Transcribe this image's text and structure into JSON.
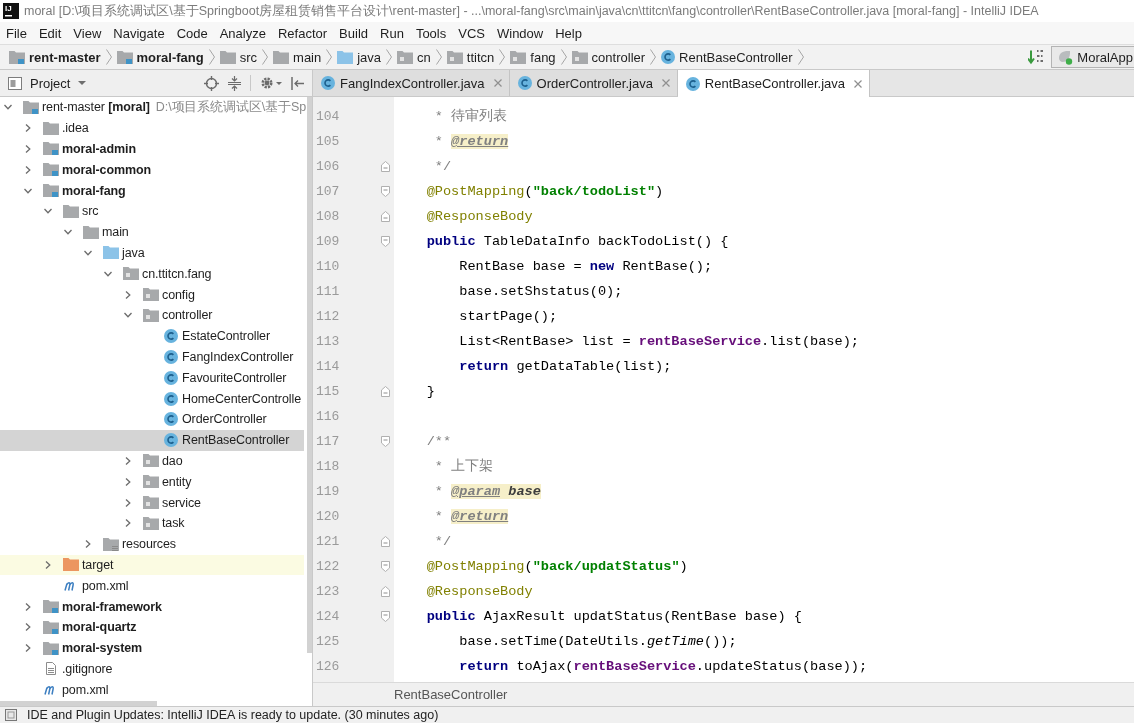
{
  "window": {
    "logo": "IJ",
    "title": "moral [D:\\项目系统调试区\\基于Springboot房屋租赁销售平台设计\\rent-master] - ...\\moral-fang\\src\\main\\java\\cn\\ttitcn\\fang\\controller\\RentBaseController.java [moral-fang] - IntelliJ IDEA"
  },
  "menu": [
    "File",
    "Edit",
    "View",
    "Navigate",
    "Code",
    "Analyze",
    "Refactor",
    "Build",
    "Run",
    "Tools",
    "VCS",
    "Window",
    "Help"
  ],
  "navigation_bar": {
    "crumbs": [
      {
        "kind": "module",
        "label": "rent-master"
      },
      {
        "kind": "module",
        "label": "moral-fang"
      },
      {
        "kind": "folder",
        "label": "src"
      },
      {
        "kind": "folder",
        "label": "main"
      },
      {
        "kind": "source-folder",
        "label": "java"
      },
      {
        "kind": "package",
        "label": "cn"
      },
      {
        "kind": "package",
        "label": "ttitcn"
      },
      {
        "kind": "package",
        "label": "fang"
      },
      {
        "kind": "package",
        "label": "controller"
      },
      {
        "kind": "class",
        "label": "RentBaseController"
      }
    ],
    "run_configuration": "MoralApp"
  },
  "project_panel": {
    "title": "Project",
    "tree": [
      {
        "kind": "project",
        "name": "rent-master **[moral]**",
        "location": "D:\\项目系统调试区\\基于Sp",
        "selected": false,
        "expanded": true,
        "children": [
          {
            "kind": "folder",
            "name": ".idea",
            "selected": false,
            "expanded": false
          },
          {
            "kind": "module",
            "name": "moral-admin",
            "selected": false,
            "expanded": false
          },
          {
            "kind": "module",
            "name": "moral-common",
            "selected": false,
            "expanded": false
          },
          {
            "kind": "module",
            "name": "moral-fang",
            "selected": false,
            "expanded": true,
            "children": [
              {
                "kind": "folder",
                "name": "src",
                "selected": false,
                "expanded": true,
                "children": [
                  {
                    "kind": "folder",
                    "name": "main",
                    "selected": false,
                    "expanded": true,
                    "children": [
                      {
                        "kind": "source-folder",
                        "name": "java",
                        "selected": false,
                        "expanded": true,
                        "children": [
                          {
                            "kind": "package",
                            "name": "cn.ttitcn.fang",
                            "selected": false,
                            "expanded": true,
                            "children": [
                              {
                                "kind": "package",
                                "name": "config",
                                "selected": false,
                                "expanded": false
                              },
                              {
                                "kind": "package",
                                "name": "controller",
                                "selected": false,
                                "expanded": true,
                                "children": [
                                  {
                                    "kind": "class",
                                    "name": "EstateController",
                                    "selected": false
                                  },
                                  {
                                    "kind": "class",
                                    "name": "FangIndexController",
                                    "selected": false
                                  },
                                  {
                                    "kind": "class",
                                    "name": "FavouriteController",
                                    "selected": false
                                  },
                                  {
                                    "kind": "class",
                                    "name": "HomeCenterControlle",
                                    "selected": false
                                  },
                                  {
                                    "kind": "class",
                                    "name": "OrderController",
                                    "selected": false
                                  },
                                  {
                                    "kind": "class",
                                    "name": "RentBaseController",
                                    "selected": true
                                  }
                                ]
                              },
                              {
                                "kind": "package",
                                "name": "dao",
                                "selected": false,
                                "expanded": false
                              },
                              {
                                "kind": "package",
                                "name": "entity",
                                "selected": false,
                                "expanded": false
                              },
                              {
                                "kind": "package",
                                "name": "service",
                                "selected": false,
                                "expanded": false
                              },
                              {
                                "kind": "package",
                                "name": "task",
                                "selected": false,
                                "expanded": false
                              }
                            ]
                          }
                        ]
                      },
                      {
                        "kind": "resources-folder",
                        "name": "resources",
                        "selected": false,
                        "expanded": false
                      }
                    ]
                  }
                ]
              },
              {
                "kind": "excluded-folder",
                "name": "target",
                "selected": false,
                "expanded": false
              },
              {
                "kind": "maven-file",
                "name": "pom.xml",
                "selected": false
              }
            ]
          },
          {
            "kind": "module",
            "name": "moral-framework",
            "selected": false,
            "expanded": false
          },
          {
            "kind": "module",
            "name": "moral-quartz",
            "selected": false,
            "expanded": false
          },
          {
            "kind": "module",
            "name": "moral-system",
            "selected": false,
            "expanded": false
          },
          {
            "kind": "text-file",
            "name": ".gitignore",
            "selected": false
          },
          {
            "kind": "maven-file",
            "name": "pom.xml",
            "selected": false
          }
        ]
      }
    ]
  },
  "editor_tabs": [
    {
      "label": "FangIndexController.java",
      "selected": false
    },
    {
      "label": "OrderController.java",
      "selected": false
    },
    {
      "label": "RentBaseController.java",
      "selected": true
    }
  ],
  "editor": {
    "lines": [
      {
        "number": "104",
        "fold_start": false,
        "fold_end": false,
        "tokens": [
          {
            "kind": "comment",
            "text": "     * 待审列表"
          }
        ]
      },
      {
        "number": "105",
        "fold_start": false,
        "fold_end": false,
        "tokens": [
          {
            "kind": "comment",
            "text": "     * "
          },
          {
            "kind": "doc-tag",
            "text": "@return"
          }
        ]
      },
      {
        "number": "106",
        "fold_start": false,
        "fold_end": true,
        "tokens": [
          {
            "kind": "comment",
            "text": "     */"
          }
        ]
      },
      {
        "number": "107",
        "fold_start": true,
        "fold_end": false,
        "tokens": [
          {
            "kind": "annotation",
            "text": "    @PostMapping"
          },
          {
            "kind": "plain",
            "text": "("
          },
          {
            "kind": "string",
            "text": "\"back/todoList\""
          },
          {
            "kind": "plain",
            "text": ")"
          }
        ]
      },
      {
        "number": "108",
        "fold_start": false,
        "fold_end": true,
        "tokens": [
          {
            "kind": "annotation",
            "text": "    @ResponseBody"
          }
        ]
      },
      {
        "number": "109",
        "fold_start": true,
        "fold_end": false,
        "tokens": [
          {
            "kind": "keyword",
            "text": "    public"
          },
          {
            "kind": "plain",
            "text": " TableDataInfo backTodoList() {"
          }
        ]
      },
      {
        "number": "110",
        "fold_start": false,
        "fold_end": false,
        "tokens": [
          {
            "kind": "plain",
            "text": "        RentBase base = "
          },
          {
            "kind": "keyword",
            "text": "new"
          },
          {
            "kind": "plain",
            "text": " RentBase();"
          }
        ]
      },
      {
        "number": "111",
        "fold_start": false,
        "fold_end": false,
        "tokens": [
          {
            "kind": "plain",
            "text": "        base.setShstatus(0);"
          }
        ]
      },
      {
        "number": "112",
        "fold_start": false,
        "fold_end": false,
        "tokens": [
          {
            "kind": "plain",
            "text": "        startPage();"
          }
        ]
      },
      {
        "number": "113",
        "fold_start": false,
        "fold_end": false,
        "tokens": [
          {
            "kind": "plain",
            "text": "        List<RentBase> list = "
          },
          {
            "kind": "field",
            "text": "rentBaseService"
          },
          {
            "kind": "plain",
            "text": ".list(base);"
          }
        ]
      },
      {
        "number": "114",
        "fold_start": false,
        "fold_end": false,
        "tokens": [
          {
            "kind": "keyword",
            "text": "        return"
          },
          {
            "kind": "plain",
            "text": " getDataTable(list);"
          }
        ]
      },
      {
        "number": "115",
        "fold_start": false,
        "fold_end": true,
        "tokens": [
          {
            "kind": "plain",
            "text": "    }"
          }
        ]
      },
      {
        "number": "116",
        "fold_start": false,
        "fold_end": false
      },
      {
        "number": "117",
        "fold_start": true,
        "fold_end": false,
        "tokens": [
          {
            "kind": "comment",
            "text": "    /**"
          }
        ]
      },
      {
        "number": "118",
        "fold_start": false,
        "fold_end": false,
        "tokens": [
          {
            "kind": "comment",
            "text": "     * 上下架"
          }
        ]
      },
      {
        "number": "119",
        "fold_start": false,
        "fold_end": false,
        "tokens": [
          {
            "kind": "comment",
            "text": "     * "
          },
          {
            "kind": "doc-tag",
            "text": "@param"
          },
          {
            "kind": "doc-param",
            "text": " base"
          }
        ]
      },
      {
        "number": "120",
        "fold_start": false,
        "fold_end": false,
        "tokens": [
          {
            "kind": "comment",
            "text": "     * "
          },
          {
            "kind": "doc-tag",
            "text": "@return"
          }
        ]
      },
      {
        "number": "121",
        "fold_start": false,
        "fold_end": true,
        "tokens": [
          {
            "kind": "comment",
            "text": "     */"
          }
        ]
      },
      {
        "number": "122",
        "fold_start": true,
        "fold_end": false,
        "tokens": [
          {
            "kind": "annotation",
            "text": "    @PostMapping"
          },
          {
            "kind": "plain",
            "text": "("
          },
          {
            "kind": "string",
            "text": "\"back/updatStatus\""
          },
          {
            "kind": "plain",
            "text": ")"
          }
        ]
      },
      {
        "number": "123",
        "fold_start": false,
        "fold_end": true,
        "tokens": [
          {
            "kind": "annotation",
            "text": "    @ResponseBody"
          }
        ]
      },
      {
        "number": "124",
        "fold_start": true,
        "fold_end": false,
        "tokens": [
          {
            "kind": "keyword",
            "text": "    public"
          },
          {
            "kind": "plain",
            "text": " AjaxResult updatStatus(RentBase base) {"
          }
        ]
      },
      {
        "number": "125",
        "fold_start": false,
        "fold_end": false,
        "tokens": [
          {
            "kind": "plain",
            "text": "        base.setTime(DateUtils."
          },
          {
            "kind": "static-call",
            "text": "getTime"
          },
          {
            "kind": "plain",
            "text": "());"
          }
        ]
      },
      {
        "number": "126",
        "fold_start": false,
        "fold_end": false,
        "tokens": [
          {
            "kind": "keyword",
            "text": "        return"
          },
          {
            "kind": "plain",
            "text": " toAjax("
          },
          {
            "kind": "field",
            "text": "rentBaseService"
          },
          {
            "kind": "plain",
            "text": ".updateStatus(base));"
          }
        ]
      }
    ],
    "breadcrumb": "RentBaseController"
  },
  "status_bar": {
    "message": "IDE and Plugin Updates: IntelliJ IDEA is ready to update. (30 minutes ago)"
  }
}
